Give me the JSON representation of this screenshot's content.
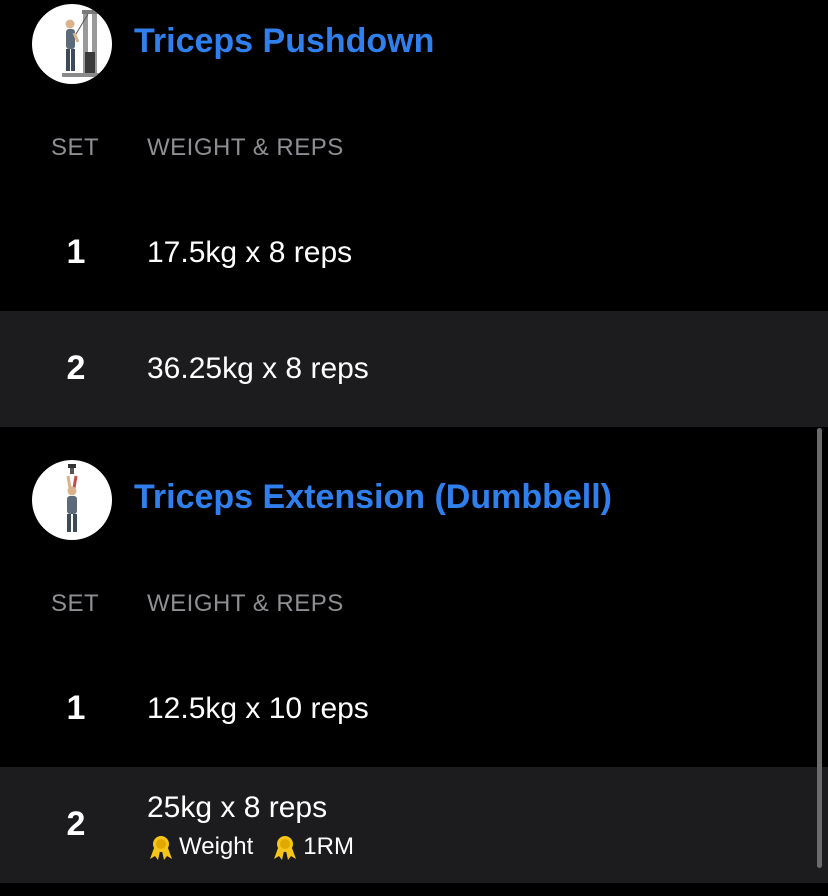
{
  "exercises": [
    {
      "title": "Triceps Pushdown",
      "icon": "triceps-pushdown-illustration",
      "columns": {
        "set": "SET",
        "weight_reps": "WEIGHT & REPS"
      },
      "sets": [
        {
          "number": "1",
          "value": "17.5kg x 8 reps"
        },
        {
          "number": "2",
          "value": "36.25kg x 8 reps"
        }
      ]
    },
    {
      "title": "Triceps Extension (Dumbbell)",
      "icon": "triceps-extension-illustration",
      "columns": {
        "set": "SET",
        "weight_reps": "WEIGHT & REPS"
      },
      "sets": [
        {
          "number": "1",
          "value": "12.5kg x 10 reps"
        },
        {
          "number": "2",
          "value": "25kg x 8 reps",
          "badges": [
            {
              "icon": "medal-icon",
              "label": "Weight"
            },
            {
              "icon": "medal-icon",
              "label": "1RM"
            }
          ]
        }
      ]
    }
  ],
  "colors": {
    "background": "#000000",
    "row_alt": "#1c1c1e",
    "title": "#2f80ed",
    "header_text": "#8e8e93",
    "medal": "#f5c518"
  }
}
